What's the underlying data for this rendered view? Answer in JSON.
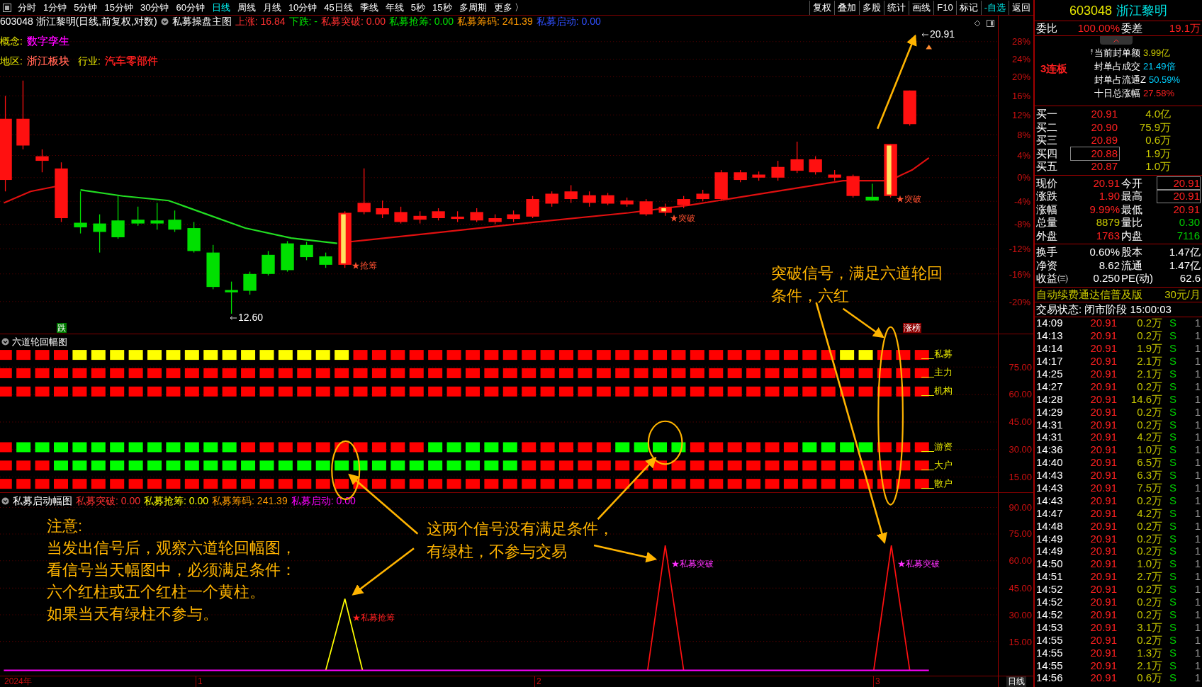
{
  "toolbar": {
    "periods": [
      {
        "label": "分时",
        "selected": false
      },
      {
        "label": "1分钟",
        "selected": false
      },
      {
        "label": "5分钟",
        "selected": false
      },
      {
        "label": "15分钟",
        "selected": false
      },
      {
        "label": "30分钟",
        "selected": false
      },
      {
        "label": "60分钟",
        "selected": false
      },
      {
        "label": "日线",
        "selected": true
      },
      {
        "label": "周线",
        "selected": false
      },
      {
        "label": "月线",
        "selected": false
      },
      {
        "label": "10分钟",
        "selected": false
      },
      {
        "label": "45日线",
        "selected": false
      },
      {
        "label": "季线",
        "selected": false
      },
      {
        "label": "年线",
        "selected": false
      },
      {
        "label": "5秒",
        "selected": false
      },
      {
        "label": "15秒",
        "selected": false
      },
      {
        "label": "多周期",
        "selected": false
      },
      {
        "label": "更多 〉",
        "selected": false
      }
    ],
    "tools": [
      {
        "label": "复权",
        "kind": "tool"
      },
      {
        "label": "叠加",
        "kind": "tool"
      },
      {
        "label": "多股",
        "kind": "tool"
      },
      {
        "label": "统计",
        "kind": "tool"
      },
      {
        "label": "画线",
        "kind": "tool"
      },
      {
        "label": "F10",
        "kind": "tool"
      },
      {
        "label": "标记",
        "kind": "tool"
      },
      {
        "label": "-自选",
        "kind": "watchlist"
      },
      {
        "label": "返回",
        "kind": "tool"
      }
    ]
  },
  "chart_header": {
    "title": "603048 浙江黎明(日线,前复权,对数)",
    "indicator": "私募操盘主图",
    "values": [
      {
        "text": "上涨: 16.84",
        "color": "#ff3030"
      },
      {
        "text": "下跌: -",
        "color": "#00e000"
      },
      {
        "text": "私募突破: 0.00",
        "color": "#ff3030"
      },
      {
        "text": "私募抢筹: 0.00",
        "color": "#00e000"
      },
      {
        "text": "私募筹码: 241.39",
        "color": "#ff9900"
      },
      {
        "text": "私募启动: 0.00",
        "color": "#3050ff"
      }
    ]
  },
  "info_rows": [
    [
      {
        "label": "概念:",
        "value": "数字孪生",
        "color": "#ff00ff"
      }
    ],
    [
      {
        "label": "地区:",
        "value": "浙江板块",
        "color": "#ff6050"
      },
      {
        "label": "行业:",
        "value": "汽车零部件",
        "color": "#ff2020"
      }
    ]
  ],
  "main_axis": [
    "28%",
    "24%",
    "20%",
    "16%",
    "12%",
    "8%",
    "4%",
    "0%",
    "-4%",
    "-8%",
    "-12%",
    "-16%",
    "-20%"
  ],
  "price_marks": {
    "high": "20.91",
    "low": "12.60"
  },
  "badges": [
    {
      "text": "跌",
      "color": "#007a00"
    },
    {
      "text": "涨榜",
      "color": "#8b0000"
    }
  ],
  "signals": [
    {
      "text": "★抢筹"
    },
    {
      "text": "★突破"
    },
    {
      "text": "★突破"
    }
  ],
  "six_path": {
    "title": "六道轮回幅图",
    "axis": [
      "75.00",
      "60.00",
      "45.00",
      "30.00",
      "15.00"
    ],
    "rows": [
      {
        "label": "私募",
        "cells": [
          {
            "color": "#ff0000"
          },
          {
            "color": "#ff0000"
          },
          {
            "color": "#ff0000"
          },
          {
            "color": "#ff0000"
          },
          {
            "color": "#ffff00"
          },
          {
            "color": "#ffff00"
          },
          {
            "color": "#ffff00"
          },
          {
            "color": "#ffff00"
          },
          {
            "color": "#ffff00"
          },
          {
            "color": "#ffff00"
          },
          {
            "color": "#ffff00"
          },
          {
            "color": "#ffff00"
          },
          {
            "color": "#ffff00"
          },
          {
            "color": "#ffff00"
          },
          {
            "color": "#ffff00"
          },
          {
            "color": "#ffff00"
          },
          {
            "color": "#ffff00"
          },
          {
            "color": "#ffff00"
          },
          {
            "color": "#ffff00"
          },
          {
            "color": "#ff0000"
          },
          {
            "color": "#ff0000"
          },
          {
            "color": "#ff0000"
          },
          {
            "color": "#ff0000"
          },
          {
            "color": "#ff0000"
          },
          {
            "color": "#ff0000"
          },
          {
            "color": "#ff0000"
          },
          {
            "color": "#ff0000"
          },
          {
            "color": "#ff0000"
          },
          {
            "color": "#ff0000"
          },
          {
            "color": "#ff0000"
          },
          {
            "color": "#ff0000"
          },
          {
            "color": "#ff0000"
          },
          {
            "color": "#ff0000"
          },
          {
            "color": "#ff0000"
          },
          {
            "color": "#ff0000"
          },
          {
            "color": "#ff0000"
          },
          {
            "color": "#ff0000"
          },
          {
            "color": "#ff0000"
          },
          {
            "color": "#ff0000"
          },
          {
            "color": "#ff0000"
          },
          {
            "color": "#ff0000"
          },
          {
            "color": "#ff0000"
          },
          {
            "color": "#ff0000"
          },
          {
            "color": "#ff0000"
          },
          {
            "color": "#ff0000"
          },
          {
            "color": "#ffff00"
          },
          {
            "color": "#ffff00"
          },
          {
            "color": "#ff0000"
          },
          {
            "color": "#ff0000"
          },
          {
            "color": "#ff0000"
          }
        ]
      },
      {
        "label": "主力",
        "cells": [
          {
            "color": "#ff0000"
          },
          {
            "color": "#ff0000"
          },
          {
            "color": "#ff0000"
          },
          {
            "color": "#ff0000"
          },
          {
            "color": "#ff0000"
          },
          {
            "color": "#ff0000"
          },
          {
            "color": "#ff0000"
          },
          {
            "color": "#ff0000"
          },
          {
            "color": "#ff0000"
          },
          {
            "color": "#ff0000"
          },
          {
            "color": "#ff0000"
          },
          {
            "color": "#ff0000"
          },
          {
            "color": "#ff0000"
          },
          {
            "color": "#ff0000"
          },
          {
            "color": "#ff0000"
          },
          {
            "color": "#ff0000"
          },
          {
            "color": "#ff0000"
          },
          {
            "color": "#ff0000"
          },
          {
            "color": "#ff0000"
          },
          {
            "color": "#ff0000"
          },
          {
            "color": "#ff0000"
          },
          {
            "color": "#ff0000"
          },
          {
            "color": "#ff0000"
          },
          {
            "color": "#ff0000"
          },
          {
            "color": "#ff0000"
          },
          {
            "color": "#ff0000"
          },
          {
            "color": "#ff0000"
          },
          {
            "color": "#ff0000"
          },
          {
            "color": "#ff0000"
          },
          {
            "color": "#ff0000"
          },
          {
            "color": "#ff0000"
          },
          {
            "color": "#ff0000"
          },
          {
            "color": "#ff0000"
          },
          {
            "color": "#ff0000"
          },
          {
            "color": "#ff0000"
          },
          {
            "color": "#ff0000"
          },
          {
            "color": "#ff0000"
          },
          {
            "color": "#ff0000"
          },
          {
            "color": "#ff0000"
          },
          {
            "color": "#ff0000"
          },
          {
            "color": "#ff0000"
          },
          {
            "color": "#ff0000"
          },
          {
            "color": "#ff0000"
          },
          {
            "color": "#ff0000"
          },
          {
            "color": "#ff0000"
          },
          {
            "color": "#ff0000"
          },
          {
            "color": "#ff0000"
          },
          {
            "color": "#ff0000"
          },
          {
            "color": "#ff0000"
          },
          {
            "color": "#ff0000"
          }
        ]
      },
      {
        "label": "机构",
        "cells": [
          {
            "color": "#ff0000"
          },
          {
            "color": "#ff0000"
          },
          {
            "color": "#ff0000"
          },
          {
            "color": "#ff0000"
          },
          {
            "color": "#ff0000"
          },
          {
            "color": "#ff0000"
          },
          {
            "color": "#ff0000"
          },
          {
            "color": "#ff0000"
          },
          {
            "color": "#ff0000"
          },
          {
            "color": "#ff0000"
          },
          {
            "color": "#ff0000"
          },
          {
            "color": "#ff0000"
          },
          {
            "color": "#ff0000"
          },
          {
            "color": "#ff0000"
          },
          {
            "color": "#ff0000"
          },
          {
            "color": "#ff0000"
          },
          {
            "color": "#ff0000"
          },
          {
            "color": "#ff0000"
          },
          {
            "color": "#ff0000"
          },
          {
            "color": "#ff0000"
          },
          {
            "color": "#ff0000"
          },
          {
            "color": "#ff0000"
          },
          {
            "color": "#ff0000"
          },
          {
            "color": "#ff0000"
          },
          {
            "color": "#ff0000"
          },
          {
            "color": "#ff0000"
          },
          {
            "color": "#ff0000"
          },
          {
            "color": "#ff0000"
          },
          {
            "color": "#ff0000"
          },
          {
            "color": "#ff0000"
          },
          {
            "color": "#ff0000"
          },
          {
            "color": "#ff0000"
          },
          {
            "color": "#ff0000"
          },
          {
            "color": "#ff0000"
          },
          {
            "color": "#ff0000"
          },
          {
            "color": "#ff0000"
          },
          {
            "color": "#ff0000"
          },
          {
            "color": "#ff0000"
          },
          {
            "color": "#ff0000"
          },
          {
            "color": "#ff0000"
          },
          {
            "color": "#ff0000"
          },
          {
            "color": "#ff0000"
          },
          {
            "color": "#ff0000"
          },
          {
            "color": "#ff0000"
          },
          {
            "color": "#ff0000"
          },
          {
            "color": "#ff0000"
          },
          {
            "color": "#ff0000"
          },
          {
            "color": "#ff0000"
          },
          {
            "color": "#ff0000"
          },
          {
            "color": "#ff0000"
          }
        ]
      },
      {
        "label": "游资",
        "cells": [
          {
            "color": "#ff0000"
          },
          {
            "color": "#00ff00"
          },
          {
            "color": "#00ff00"
          },
          {
            "color": "#00ff00"
          },
          {
            "color": "#00ff00"
          },
          {
            "color": "#00ff00"
          },
          {
            "color": "#00ff00"
          },
          {
            "color": "#00ff00"
          },
          {
            "color": "#00ff00"
          },
          {
            "color": "#00ff00"
          },
          {
            "color": "#00ff00"
          },
          {
            "color": "#00ff00"
          },
          {
            "color": "#00ff00"
          },
          {
            "color": "#ff0000"
          },
          {
            "color": "#ff0000"
          },
          {
            "color": "#ff0000"
          },
          {
            "color": "#ff0000"
          },
          {
            "color": "#ff0000"
          },
          {
            "color": "#ff0000"
          },
          {
            "color": "#ff0000"
          },
          {
            "color": "#ff0000"
          },
          {
            "color": "#ff0000"
          },
          {
            "color": "#ff0000"
          },
          {
            "color": "#00ff00"
          },
          {
            "color": "#00ff00"
          },
          {
            "color": "#00ff00"
          },
          {
            "color": "#00ff00"
          },
          {
            "color": "#00ff00"
          },
          {
            "color": "#ff0000"
          },
          {
            "color": "#ff0000"
          },
          {
            "color": "#ff0000"
          },
          {
            "color": "#ff0000"
          },
          {
            "color": "#ff0000"
          },
          {
            "color": "#00ff00"
          },
          {
            "color": "#00ff00"
          },
          {
            "color": "#00ff00"
          },
          {
            "color": "#00ff00"
          },
          {
            "color": "#ff0000"
          },
          {
            "color": "#ff0000"
          },
          {
            "color": "#ff0000"
          },
          {
            "color": "#ff0000"
          },
          {
            "color": "#ff0000"
          },
          {
            "color": "#ff0000"
          },
          {
            "color": "#00ff00"
          },
          {
            "color": "#00ff00"
          },
          {
            "color": "#00ff00"
          },
          {
            "color": "#00ff00"
          },
          {
            "color": "#ff0000"
          },
          {
            "color": "#ff0000"
          },
          {
            "color": "#ff0000"
          }
        ]
      },
      {
        "label": "大户",
        "cells": [
          {
            "color": "#ff0000"
          },
          {
            "color": "#ff0000"
          },
          {
            "color": "#ff0000"
          },
          {
            "color": "#00ff00"
          },
          {
            "color": "#00ff00"
          },
          {
            "color": "#00ff00"
          },
          {
            "color": "#00ff00"
          },
          {
            "color": "#00ff00"
          },
          {
            "color": "#00ff00"
          },
          {
            "color": "#00ff00"
          },
          {
            "color": "#00ff00"
          },
          {
            "color": "#00ff00"
          },
          {
            "color": "#00ff00"
          },
          {
            "color": "#00ff00"
          },
          {
            "color": "#00ff00"
          },
          {
            "color": "#00ff00"
          },
          {
            "color": "#00ff00"
          },
          {
            "color": "#00ff00"
          },
          {
            "color": "#00ff00"
          },
          {
            "color": "#00ff00"
          },
          {
            "color": "#00ff00"
          },
          {
            "color": "#00ff00"
          },
          {
            "color": "#00ff00"
          },
          {
            "color": "#00ff00"
          },
          {
            "color": "#00ff00"
          },
          {
            "color": "#00ff00"
          },
          {
            "color": "#00ff00"
          },
          {
            "color": "#00ff00"
          },
          {
            "color": "#ff0000"
          },
          {
            "color": "#ff0000"
          },
          {
            "color": "#ff0000"
          },
          {
            "color": "#ff0000"
          },
          {
            "color": "#ff0000"
          },
          {
            "color": "#ff0000"
          },
          {
            "color": "#ff0000"
          },
          {
            "color": "#ff0000"
          },
          {
            "color": "#ff0000"
          },
          {
            "color": "#ff0000"
          },
          {
            "color": "#ff0000"
          },
          {
            "color": "#ff0000"
          },
          {
            "color": "#ff0000"
          },
          {
            "color": "#ff0000"
          },
          {
            "color": "#ff0000"
          },
          {
            "color": "#ff0000"
          },
          {
            "color": "#ff0000"
          },
          {
            "color": "#ff0000"
          },
          {
            "color": "#ff0000"
          },
          {
            "color": "#ff0000"
          },
          {
            "color": "#ff0000"
          },
          {
            "color": "#ff0000"
          }
        ]
      },
      {
        "label": "散户",
        "cells": [
          {
            "color": "#ff0000"
          },
          {
            "color": "#ff0000"
          },
          {
            "color": "#ff0000"
          },
          {
            "color": "#ff0000"
          },
          {
            "color": "#ff0000"
          },
          {
            "color": "#ff0000"
          },
          {
            "color": "#ff0000"
          },
          {
            "color": "#ff0000"
          },
          {
            "color": "#ff0000"
          },
          {
            "color": "#ff0000"
          },
          {
            "color": "#ff0000"
          },
          {
            "color": "#ff0000"
          },
          {
            "color": "#ff0000"
          },
          {
            "color": "#ff0000"
          },
          {
            "color": "#ff0000"
          },
          {
            "color": "#ff0000"
          },
          {
            "color": "#ff0000"
          },
          {
            "color": "#ff0000"
          },
          {
            "color": "#ff0000"
          },
          {
            "color": "#ff0000"
          },
          {
            "color": "#ff0000"
          },
          {
            "color": "#ff0000"
          },
          {
            "color": "#ff0000"
          },
          {
            "color": "#ff0000"
          },
          {
            "color": "#ff0000"
          },
          {
            "color": "#ff0000"
          },
          {
            "color": "#ff0000"
          },
          {
            "color": "#ff0000"
          },
          {
            "color": "#ff0000"
          },
          {
            "color": "#ff0000"
          },
          {
            "color": "#ff0000"
          },
          {
            "color": "#ff0000"
          },
          {
            "color": "#ff0000"
          },
          {
            "color": "#ff0000"
          },
          {
            "color": "#ff0000"
          },
          {
            "color": "#ff0000"
          },
          {
            "color": "#ff0000"
          },
          {
            "color": "#ff0000"
          },
          {
            "color": "#ff0000"
          },
          {
            "color": "#ff0000"
          },
          {
            "color": "#ff0000"
          },
          {
            "color": "#ff0000"
          },
          {
            "color": "#ff0000"
          },
          {
            "color": "#ff0000"
          },
          {
            "color": "#ff0000"
          },
          {
            "color": "#ff0000"
          },
          {
            "color": "#ff0000"
          },
          {
            "color": "#ff0000"
          },
          {
            "color": "#ff0000"
          },
          {
            "color": "#ff0000"
          }
        ]
      }
    ]
  },
  "start_panel": {
    "title": "私募启动幅图",
    "values": [
      {
        "text": "私募突破: 0.00",
        "color": "#ff3030"
      },
      {
        "text": "私募抢筹: 0.00",
        "color": "#ffff00"
      },
      {
        "text": "私募筹码: 241.39",
        "color": "#ff9900"
      },
      {
        "text": "私募启动: 0.00",
        "color": "#ff00ff"
      }
    ],
    "axis": [
      "90.00",
      "75.00",
      "60.00",
      "45.00",
      "30.00",
      "15.00"
    ],
    "signals": [
      {
        "text": "★私募抢筹",
        "color": "#ff2020"
      },
      {
        "text": "★私募突破",
        "color": "#ff30ff"
      },
      {
        "text": "★私募突破",
        "color": "#ff30ff"
      }
    ]
  },
  "date_axis": {
    "year": "2024年",
    "months": [
      "1",
      "2",
      "3"
    ],
    "period": "日线"
  },
  "annotations": {
    "note_title": "注意:",
    "note_lines": [
      "当发出信号后，观察六道轮回幅图，",
      "看信号当天幅图中，必须满足条件：",
      "六个红柱或五个红柱一个黄柱。",
      "如果当天有绿柱不参与。"
    ],
    "callout_breakout": [
      "突破信号，满足六道轮回",
      "条件，六红"
    ],
    "callout_green": [
      "这两个信号没有满足条件，",
      "有绿柱，不参与交易"
    ]
  },
  "quote": {
    "code": "603048",
    "name": "浙江黎明",
    "ratio": {
      "label1": "委比",
      "value1": "100.00%",
      "label2": "委差",
      "value2": "19.1万"
    },
    "streak": "3连板",
    "seal": [
      {
        "label": "当前封单额",
        "value": "3.99亿",
        "color": "#c8c800"
      },
      {
        "label": "封单占成交",
        "value": "21.49倍",
        "color": "#00d0ff"
      },
      {
        "label": "封单占流通Z",
        "value": "50.59%",
        "color": "#00d0ff"
      },
      {
        "label": "十日总涨幅",
        "value": "27.58%",
        "color": "#ff2020"
      }
    ],
    "bids": [
      {
        "label": "买一",
        "price": "20.91",
        "volume": "4.0亿",
        "boxed": false
      },
      {
        "label": "买二",
        "price": "20.90",
        "volume": "75.9万",
        "boxed": false
      },
      {
        "label": "买三",
        "price": "20.89",
        "volume": "0.6万",
        "boxed": false
      },
      {
        "label": "买四",
        "price": "20.88",
        "volume": "1.9万",
        "boxed": true
      },
      {
        "label": "买五",
        "price": "20.87",
        "volume": "1.0万",
        "boxed": false
      }
    ],
    "stats": [
      {
        "left": {
          "label": "现价",
          "value": "20.91",
          "color": "#ff2020"
        },
        "right": {
          "label": "今开",
          "value": "20.91",
          "color": "#ff2020",
          "boxed": true
        }
      },
      {
        "left": {
          "label": "涨跌",
          "value": "1.90",
          "color": "#ff2020"
        },
        "right": {
          "label": "最高",
          "value": "20.91",
          "color": "#ff2020",
          "boxed": true
        }
      },
      {
        "left": {
          "label": "涨幅",
          "value": "9.99%",
          "color": "#ff2020"
        },
        "right": {
          "label": "最低",
          "value": "20.91",
          "color": "#ff2020",
          "boxed": false
        }
      },
      {
        "left": {
          "label": "总量",
          "value": "8879",
          "color": "#c8c800"
        },
        "right": {
          "label": "量比",
          "value": "0.30",
          "color": "#00d000",
          "boxed": false
        }
      },
      {
        "left": {
          "label": "外盘",
          "value": "1763",
          "color": "#ff2020"
        },
        "right": {
          "label": "内盘",
          "value": "7116",
          "color": "#00d000",
          "boxed": false
        }
      }
    ],
    "fundamentals": [
      {
        "label1": "换手",
        "value1": "0.60%",
        "label2": "股本",
        "value2": "1.47亿"
      },
      {
        "label1": "净资",
        "value1": "8.62",
        "label2": "流通",
        "value2": "1.47亿"
      },
      {
        "label1": "收益㈢",
        "value1": "0.250",
        "label2": "PE(动)",
        "value2": "62.6"
      }
    ],
    "promo": {
      "text": "自动续费通达信普及版",
      "price": "30元/月"
    },
    "status": "交易状态: 闭市阶段 15:00:03",
    "ticks": [
      {
        "time": "14:09",
        "price": "20.91",
        "volume": "0.2万",
        "side": "S",
        "count": "1"
      },
      {
        "time": "14:13",
        "price": "20.91",
        "volume": "0.2万",
        "side": "S",
        "count": "1"
      },
      {
        "time": "14:14",
        "price": "20.91",
        "volume": "1.9万",
        "side": "S",
        "count": "1"
      },
      {
        "time": "14:17",
        "price": "20.91",
        "volume": "2.1万",
        "side": "S",
        "count": "1"
      },
      {
        "time": "14:25",
        "price": "20.91",
        "volume": "2.1万",
        "side": "S",
        "count": "1"
      },
      {
        "time": "14:27",
        "price": "20.91",
        "volume": "0.2万",
        "side": "S",
        "count": "1"
      },
      {
        "time": "14:28",
        "price": "20.91",
        "volume": "14.6万",
        "side": "S",
        "count": "1"
      },
      {
        "time": "14:29",
        "price": "20.91",
        "volume": "0.2万",
        "side": "S",
        "count": "1"
      },
      {
        "time": "14:31",
        "price": "20.91",
        "volume": "0.2万",
        "side": "S",
        "count": "1"
      },
      {
        "time": "14:31",
        "price": "20.91",
        "volume": "4.2万",
        "side": "S",
        "count": "1"
      },
      {
        "time": "14:36",
        "price": "20.91",
        "volume": "1.0万",
        "side": "S",
        "count": "1"
      },
      {
        "time": "14:40",
        "price": "20.91",
        "volume": "6.5万",
        "side": "S",
        "count": "1"
      },
      {
        "time": "14:43",
        "price": "20.91",
        "volume": "6.3万",
        "side": "S",
        "count": "1"
      },
      {
        "time": "14:43",
        "price": "20.91",
        "volume": "7.5万",
        "side": "S",
        "count": "1"
      },
      {
        "time": "14:43",
        "price": "20.91",
        "volume": "0.2万",
        "side": "S",
        "count": "1"
      },
      {
        "time": "14:47",
        "price": "20.91",
        "volume": "4.2万",
        "side": "S",
        "count": "1"
      },
      {
        "time": "14:48",
        "price": "20.91",
        "volume": "0.2万",
        "side": "S",
        "count": "1"
      },
      {
        "time": "14:49",
        "price": "20.91",
        "volume": "0.2万",
        "side": "S",
        "count": "1"
      },
      {
        "time": "14:49",
        "price": "20.91",
        "volume": "0.2万",
        "side": "S",
        "count": "1"
      },
      {
        "time": "14:50",
        "price": "20.91",
        "volume": "1.0万",
        "side": "S",
        "count": "1"
      },
      {
        "time": "14:51",
        "price": "20.91",
        "volume": "2.7万",
        "side": "S",
        "count": "1"
      },
      {
        "time": "14:52",
        "price": "20.91",
        "volume": "0.2万",
        "side": "S",
        "count": "1"
      },
      {
        "time": "14:52",
        "price": "20.91",
        "volume": "0.2万",
        "side": "S",
        "count": "1"
      },
      {
        "time": "14:52",
        "price": "20.91",
        "volume": "0.2万",
        "side": "S",
        "count": "1"
      },
      {
        "time": "14:53",
        "price": "20.91",
        "volume": "3.1万",
        "side": "S",
        "count": "1"
      },
      {
        "time": "14:55",
        "price": "20.91",
        "volume": "0.2万",
        "side": "S",
        "count": "1"
      },
      {
        "time": "14:55",
        "price": "20.91",
        "volume": "1.3万",
        "side": "S",
        "count": "1"
      },
      {
        "time": "14:55",
        "price": "20.91",
        "volume": "2.1万",
        "side": "S",
        "count": "1"
      },
      {
        "time": "14:56",
        "price": "20.91",
        "volume": "0.6万",
        "side": "S",
        "count": "1"
      }
    ]
  }
}
